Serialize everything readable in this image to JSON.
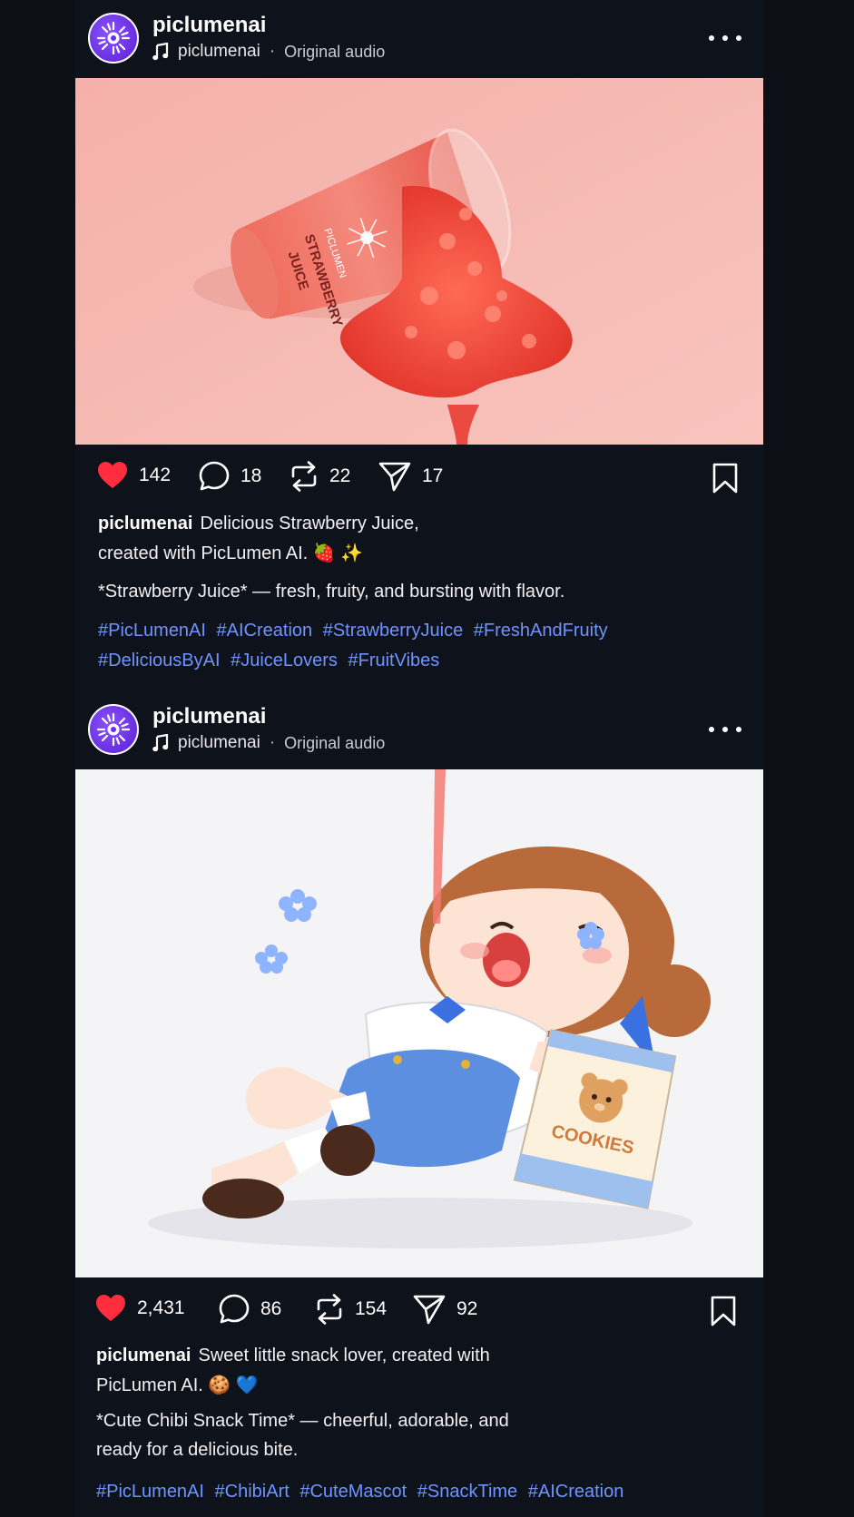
{
  "posts": [
    {
      "author": "piclumenai",
      "audio_author": "piclumenai",
      "audio_sep": "·",
      "audio_label": "Original audio",
      "image_text": {
        "cup_line1": "PICLUMEN",
        "cup_line2": "STRAWBERRY",
        "cup_line3": "JUICE"
      },
      "likes": "142",
      "comments": "18",
      "reposts": "22",
      "shares": "17",
      "caption_line1": "Delicious Strawberry Juice,",
      "caption_line2": "created with PicLumen AI.",
      "caption_emoji": "🍓 ✨",
      "subcaption": "*Strawberry Juice* — fresh, fruity, and bursting with flavor.",
      "tags": [
        "#PicLumenAI",
        "#AICreation",
        "#StrawberryJuice",
        "#FreshAndFruity",
        "#DeliciousByAI",
        "#JuiceLovers",
        "#FruitVibes"
      ]
    },
    {
      "author": "piclumenai",
      "audio_author": "piclumenai",
      "audio_sep": "·",
      "audio_label": "Original audio",
      "image_text": {
        "bag_label": "COOKIES"
      },
      "likes": "2,431",
      "comments": "86",
      "reposts": "154",
      "shares": "92",
      "caption_line1": "Sweet little snack lover, created with",
      "caption_line2": "PicLumen AI.",
      "caption_emoji": "🍪 💙",
      "subcaption_line1": "*Cute Chibi Snack Time* — cheerful, adorable, and",
      "subcaption_line2": "ready for a delicious bite.",
      "tags": [
        "#PicLumenAI",
        "#ChibiArt",
        "#CuteMascot",
        "#SnackTime",
        "#AICreation"
      ]
    }
  ],
  "colors": {
    "background": "#0c1016",
    "heart": "#ff2d3d",
    "hashtag": "#6f94ff",
    "avatar": "#6a2cf0",
    "juice": "#e8463f"
  },
  "icons": [
    "piclumen-logo-icon",
    "music-note-icon",
    "more-icon",
    "heart-icon",
    "comment-icon",
    "repost-icon",
    "send-icon",
    "bookmark-icon"
  ]
}
